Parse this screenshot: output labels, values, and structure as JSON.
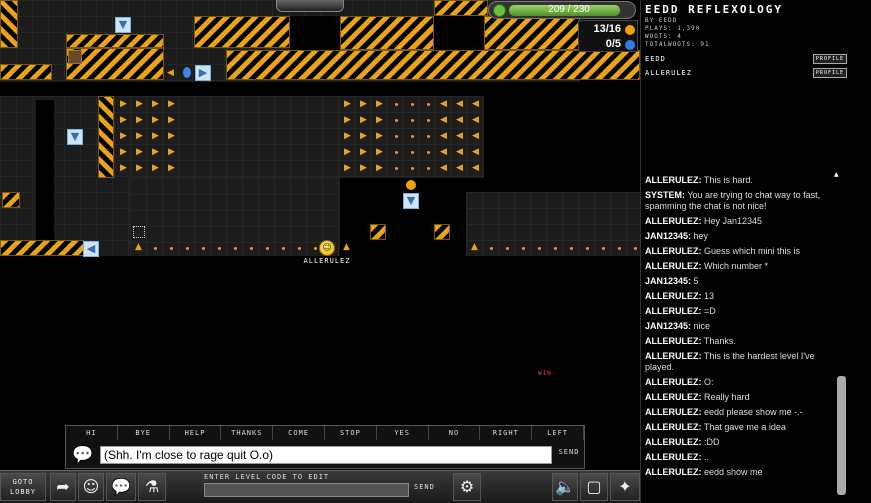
{
  "hud": {
    "energy_text": "209 / 230",
    "energy_fraction": 0.909,
    "coins_collected": "13/16",
    "blue_coins": "0/5",
    "colors": {
      "coin": "#f5a000",
      "blue_coin": "#2f7fe0",
      "hazard": "#e8a317"
    }
  },
  "player": {
    "name": "ALLERULEZ"
  },
  "world_labels": {
    "win": "WIN"
  },
  "quick_chat": [
    "HI",
    "BYE",
    "HELP",
    "THANKS",
    "COME",
    "STOP",
    "YES",
    "NO",
    "RIGHT",
    "LEFT"
  ],
  "chat_input": {
    "value": "(Shh. I'm close to rage quit O.o)",
    "send": "SEND"
  },
  "toolbar": {
    "goto_lobby": "GOTO LOBBY",
    "level_code_label": "ENTER LEVEL CODE TO EDIT",
    "level_code_send": "SEND"
  },
  "sidebar": {
    "title": "EEDD REFLEXOLOGY",
    "by": "BY EEDD",
    "plays": "PLAYS: 1,390",
    "woots": "WOOTS: 4",
    "totalwoots": "TOTALWOOTS: 91",
    "profile_label": "PROFILE",
    "users": [
      "EEDD",
      "ALLERULEZ"
    ]
  },
  "chat": [
    {
      "user": "ALLERULEZ:",
      "text": "This is hard."
    },
    {
      "user": "SYSTEM:",
      "text": "You are trying to chat way to fast, spamming the chat is not nice!"
    },
    {
      "user": "ALLERULEZ:",
      "text": "Hey Jan12345"
    },
    {
      "user": "JAN12345:",
      "text": "hey"
    },
    {
      "user": "ALLERULEZ:",
      "text": "Guess which mini this is"
    },
    {
      "user": "ALLERULEZ:",
      "text": "Which number *"
    },
    {
      "user": "JAN12345:",
      "text": "5"
    },
    {
      "user": "ALLERULEZ:",
      "text": "13"
    },
    {
      "user": "ALLERULEZ:",
      "text": "=D"
    },
    {
      "user": "JAN12345:",
      "text": "nice"
    },
    {
      "user": "ALLERULEZ:",
      "text": "Thanks."
    },
    {
      "user": "ALLERULEZ:",
      "text": "This is the hardest level I've played."
    },
    {
      "user": "ALLERULEZ:",
      "text": "O:"
    },
    {
      "user": "ALLERULEZ:",
      "text": "Really hard"
    },
    {
      "user": "ALLERULEZ:",
      "text": "eedd please show me -.-"
    },
    {
      "user": "ALLERULEZ:",
      "text": "That gave me a idea"
    },
    {
      "user": "ALLERULEZ:",
      "text": ":DD"
    },
    {
      "user": "ALLERULEZ:",
      "text": ".."
    },
    {
      "user": "ALLERULEZ:",
      "text": "eedd show me"
    }
  ]
}
